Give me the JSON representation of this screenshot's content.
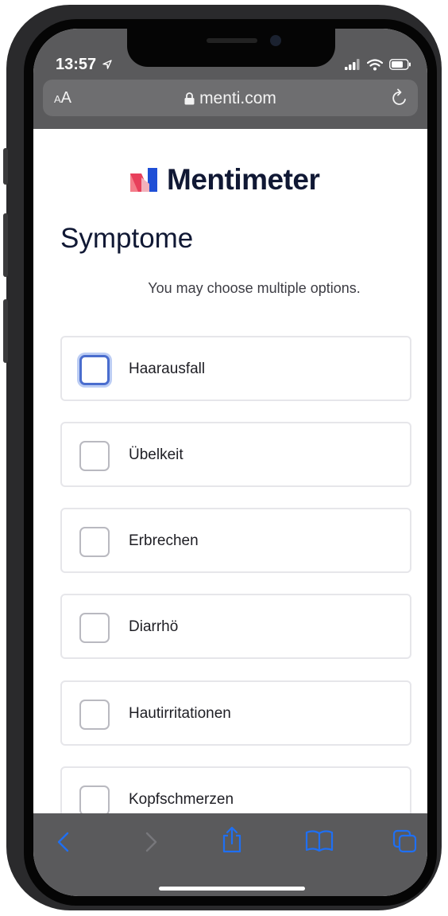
{
  "status_bar": {
    "time": "13:57"
  },
  "browser": {
    "text_size_label_small": "A",
    "text_size_label_large": "A",
    "url": "menti.com"
  },
  "page": {
    "brand": "Mentimeter",
    "title": "Symptome",
    "hint": "You may choose multiple options.",
    "options": [
      {
        "label": "Haarausfall",
        "checked": false
      },
      {
        "label": "Übelkeit",
        "checked": false
      },
      {
        "label": "Erbrechen",
        "checked": false
      },
      {
        "label": "Diarrhö",
        "checked": false
      },
      {
        "label": "Hautirritationen",
        "checked": false
      },
      {
        "label": "Kopfschmerzen",
        "checked": false
      }
    ]
  },
  "toolbar": {
    "icons": [
      "back-icon",
      "forward-icon",
      "share-icon",
      "bookmarks-icon",
      "tabs-icon"
    ]
  },
  "colors": {
    "brand_text": "#101834",
    "accent": "#4a6dce",
    "safari_chrome": "#5a5a5c"
  }
}
